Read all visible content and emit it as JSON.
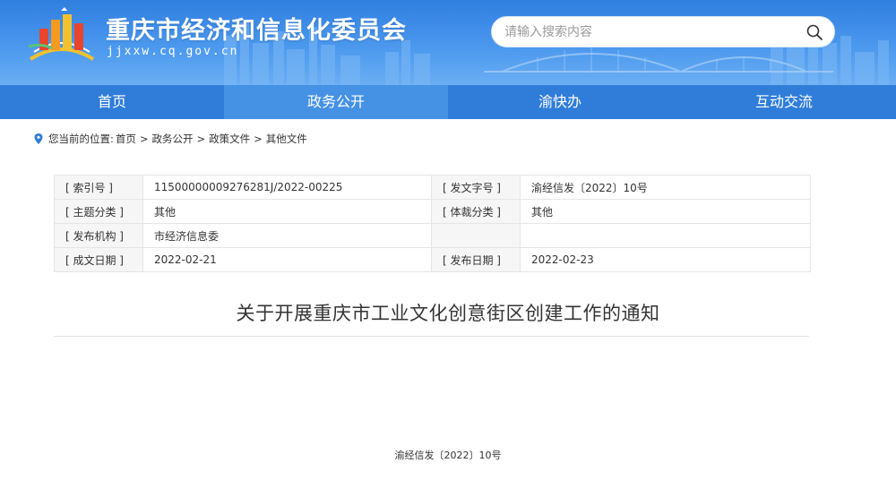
{
  "header": {
    "site_title": "重庆市经济和信息化委员会",
    "site_domain": "jjxxw.cq.gov.cn",
    "search": {
      "placeholder": "请输入搜索内容"
    }
  },
  "nav": {
    "items": [
      {
        "label": "首页"
      },
      {
        "label": "政务公开"
      },
      {
        "label": "渝快办"
      },
      {
        "label": "互动交流"
      }
    ],
    "active_index": 1
  },
  "breadcrumb": {
    "prefix": "您当前的位置:",
    "items": [
      "首页",
      "政务公开",
      "政策文件",
      "其他文件"
    ],
    "separator": ">"
  },
  "meta": {
    "index_no_label": "[ 索引号 ]",
    "index_no": "11500000009276281J/2022-00225",
    "doc_no_label": "[ 发文字号 ]",
    "doc_no": "渝经信发〔2022〕10号",
    "topic_label": "[ 主题分类 ]",
    "topic": "其他",
    "genre_label": "[ 体裁分类 ]",
    "genre": "其他",
    "issuer_label": "[ 发布机构 ]",
    "issuer": "市经济信息委",
    "created_label": "[ 成文日期 ]",
    "created": "2022-02-21",
    "published_label": "[ 发布日期 ]",
    "published": "2022-02-23"
  },
  "document": {
    "title": "关于开展重庆市工业文化创意街区创建工作的通知",
    "number": "渝经信发〔2022〕10号"
  },
  "colors": {
    "header_blue": "#2f7fe0",
    "nav_blue": "#2f7dd9",
    "nav_active": "#4591e3"
  }
}
